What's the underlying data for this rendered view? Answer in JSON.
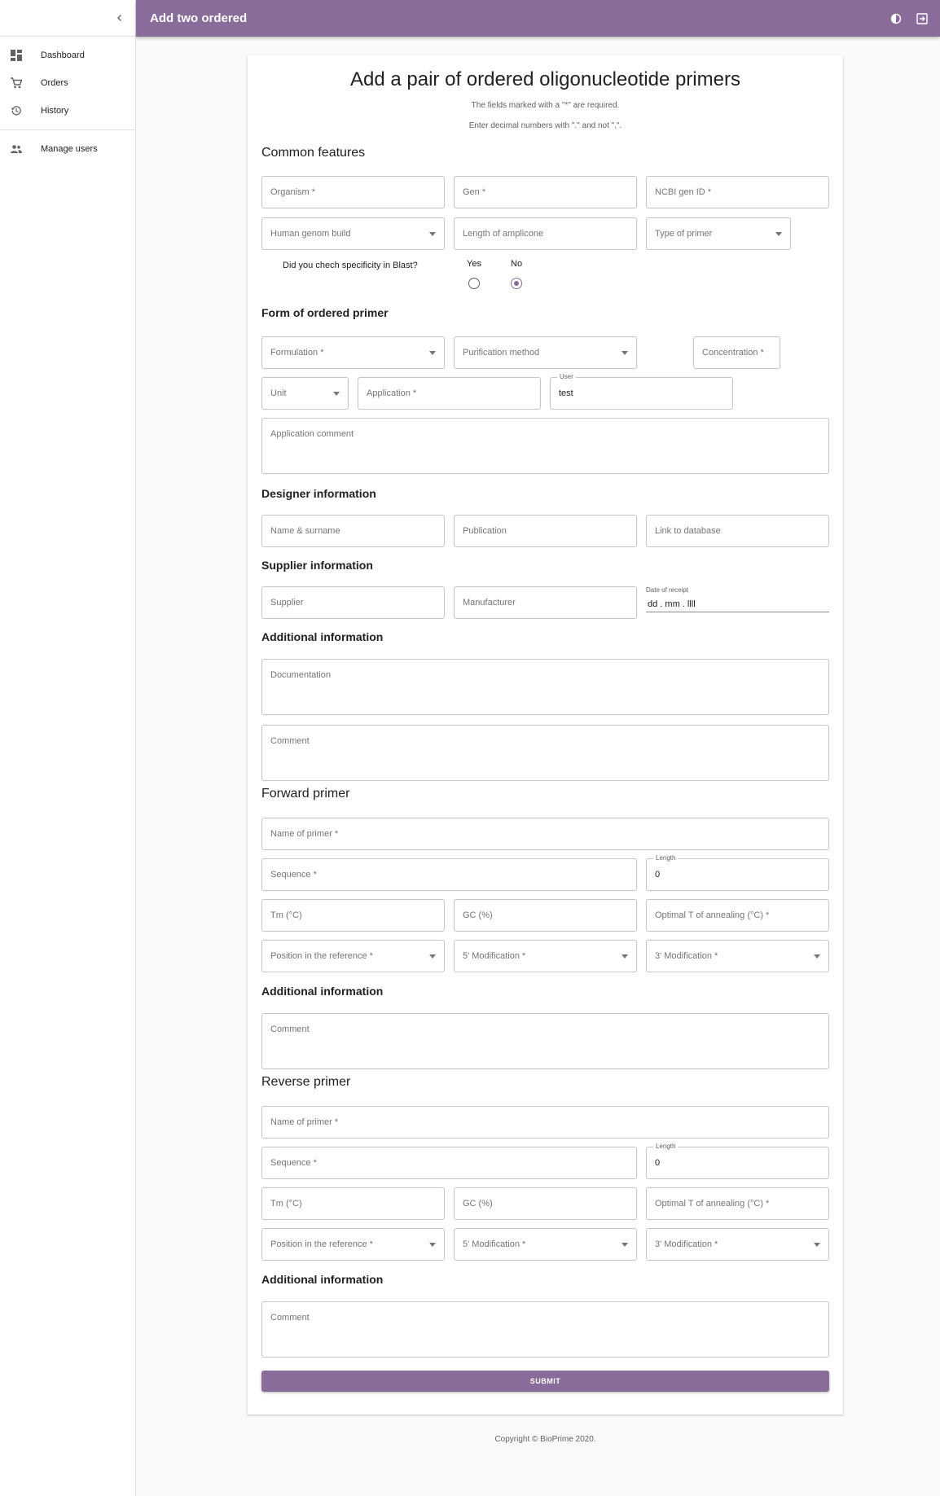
{
  "appbar": {
    "title": "Add two ordered",
    "contrast_icon": "contrast-icon",
    "logout_icon": "logout-icon"
  },
  "sidebar": {
    "items": [
      {
        "label": "Dashboard",
        "icon": "dashboard-icon"
      },
      {
        "label": "Orders",
        "icon": "cart-icon"
      },
      {
        "label": "History",
        "icon": "history-icon"
      },
      {
        "label": "Manage users",
        "icon": "users-icon"
      }
    ]
  },
  "page": {
    "title": "Add a pair of ordered oligonucleotide primers",
    "note_required": "The fields marked with a \"*\" are required.",
    "note_decimal": "Enter decimal numbers with \".\" and not \",\"."
  },
  "common": {
    "title": "Common features",
    "organism": "Organism *",
    "gen": "Gen *",
    "ncbi": "NCBI gen ID *",
    "genom_build": "Human genom build",
    "amplicone": "Length of amplicone",
    "primer_type": "Type of primer",
    "blast_q": "Did you chech specificity in Blast?",
    "yes": "Yes",
    "no": "No",
    "selected": "No"
  },
  "form": {
    "title": "Form of ordered primer",
    "formulation": "Formulation *",
    "purification": "Purification method",
    "concentration": "Concentration *",
    "unit": "Unit",
    "application": "Application *",
    "user_label": "User",
    "user_value": "test",
    "app_comment": "Application comment"
  },
  "designer": {
    "title": "Designer information",
    "name": "Name & surname",
    "publication": "Publication",
    "link": "Link to database"
  },
  "supplier": {
    "title": "Supplier information",
    "supplier": "Supplier",
    "manufacturer": "Manufacturer",
    "date_label": "Date of receipt",
    "date_value": "dd . mm . llll"
  },
  "additional": {
    "title": "Additional information",
    "documentation": "Documentation",
    "comment": "Comment"
  },
  "forward": {
    "title": "Forward primer",
    "name": "Name of primer *",
    "sequence": "Sequence *",
    "length_label": "Length",
    "length_value": "0",
    "tm": "Tm (°C)",
    "gc": "GC (%)",
    "annealing": "Optimal T of annealing (°C) *",
    "position": "Position in the reference *",
    "mod5": "5' Modification *",
    "mod3": "3' Modification *",
    "add_title": "Additional information",
    "comment": "Comment"
  },
  "reverse": {
    "title": "Reverse primer",
    "name": "Name of primer *",
    "sequence": "Sequence *",
    "length_label": "Length",
    "length_value": "0",
    "tm": "Tm (°C)",
    "gc": "GC (%)",
    "annealing": "Optimal T of annealing (°C) *",
    "position": "Position in the reference *",
    "mod5": "5' Modification *",
    "mod3": "3' Modification *",
    "add_title": "Additional information",
    "comment": "Comment"
  },
  "submit_label": "SUBMIT",
  "footer": "Copyright © BioPrime 2020.",
  "colors": {
    "primary": "#8a6c9a"
  }
}
